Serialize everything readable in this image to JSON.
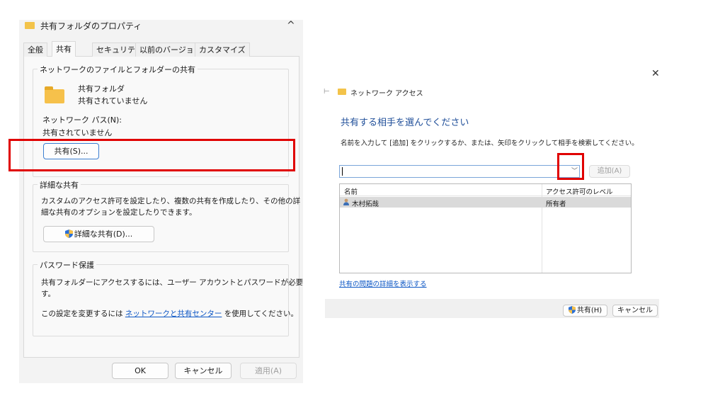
{
  "props_dialog": {
    "title": "共有フォルダのプロパティ",
    "tabs": [
      {
        "label": "全般"
      },
      {
        "label": "共有"
      },
      {
        "label": "セキュリティ"
      },
      {
        "label": "以前のバージョン"
      },
      {
        "label": "カスタマイズ"
      }
    ],
    "active_tab": "共有",
    "network_group": {
      "label": "ネットワークのファイルとフォルダーの共有",
      "folder_name": "共有フォルダ",
      "folder_status": "共有されていません",
      "path_label": "ネットワーク パス(N):",
      "path_value": "共有されていません",
      "share_button": "共有(S)..."
    },
    "advanced_group": {
      "label": "詳細な共有",
      "description_line1": "カスタムのアクセス許可を設定したり、複数の共有を作成したり、その他の詳",
      "description_line2": "細な共有のオプションを設定したりできます。",
      "button": "詳細な共有(D)..."
    },
    "password_group": {
      "label": "パスワード保護",
      "line1": "共有フォルダーにアクセスするには、ユーザー アカウントとパスワードが必要で",
      "line2": "す。",
      "change_prefix": "この設定を変更するには",
      "change_link": "ネットワークと共有センター",
      "change_suffix": "を使用してください。"
    },
    "footer": {
      "ok": "OK",
      "cancel": "キャンセル",
      "apply": "適用(A)"
    }
  },
  "net_dialog": {
    "title": "ネットワーク アクセス",
    "heading": "共有する相手を選んでください",
    "description": "名前を入力して [追加] をクリックするか、または、矢印をクリックして相手を検索してください。",
    "name_input_value": "",
    "add_button": "追加(A)",
    "columns": [
      "名前",
      "アクセス許可のレベル"
    ],
    "rows": [
      {
        "name": "木村拓哉",
        "level": "所有者"
      }
    ],
    "detail_link": "共有の問題の詳細を表示する",
    "share_button": "共有(H)",
    "cancel_button": "キャンセル"
  },
  "colors": {
    "highlight": "#e00000",
    "link": "#0a55c4",
    "heading": "#1f4e99",
    "folder": "#f6c14b"
  },
  "icons": {
    "folder": "folder-icon",
    "close": "close-icon",
    "shield": "uac-shield-icon",
    "user": "user-icon",
    "dropdown": "chevron-down-icon"
  }
}
